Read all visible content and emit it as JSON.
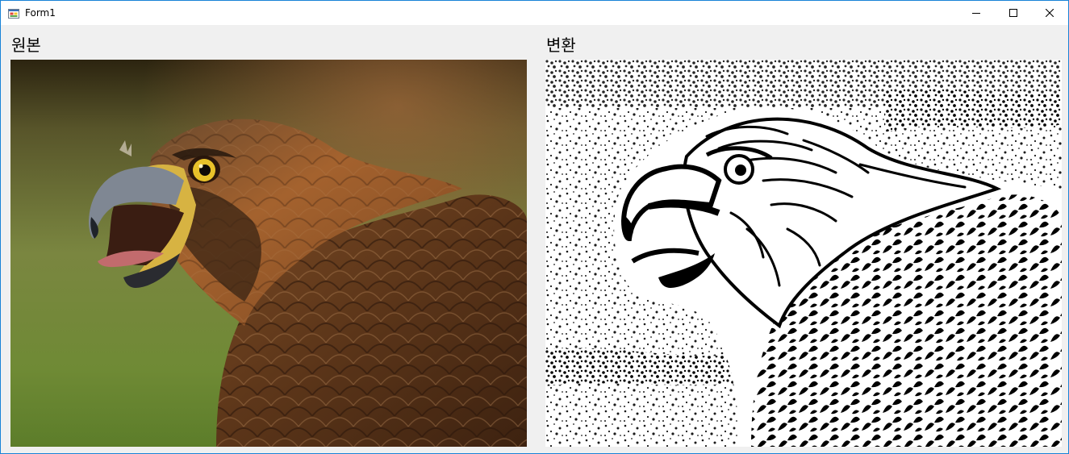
{
  "window": {
    "title": "Form1",
    "app_icon": "winforms-app-icon",
    "controls": {
      "minimize_icon": "minimize-icon",
      "maximize_icon": "maximize-icon",
      "close_icon": "close-icon"
    }
  },
  "panels": {
    "original": {
      "label": "원본",
      "image": "eagle-photo-original"
    },
    "converted": {
      "label": "변환",
      "image": "eagle-photo-sketch-converted"
    }
  },
  "colors": {
    "window_border": "#1883d7",
    "client_bg": "#f0f0f0"
  }
}
